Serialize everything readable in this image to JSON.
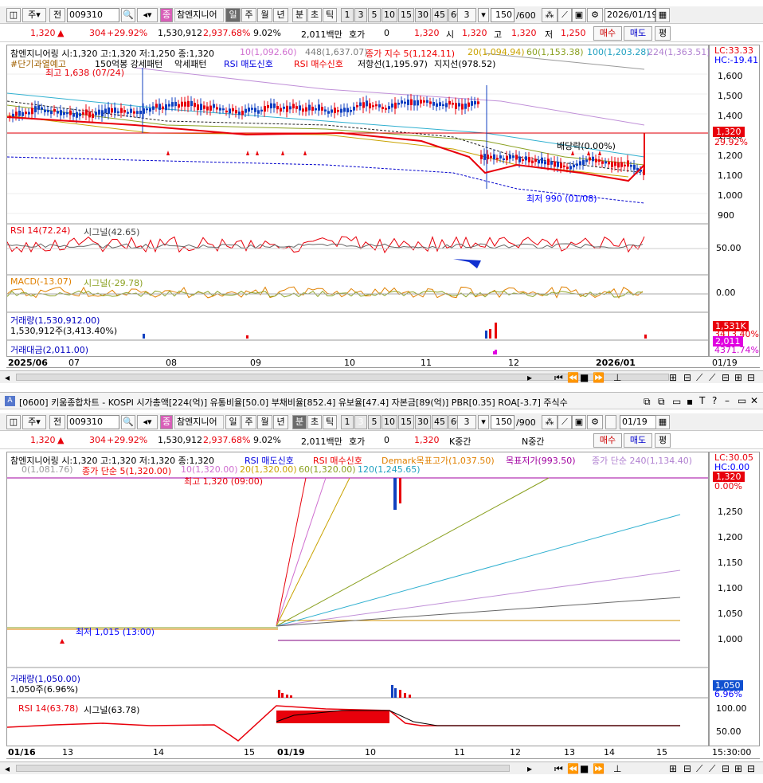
{
  "top": {
    "toolbar": {
      "type_label": "주",
      "prev_label": "전",
      "code": "009310",
      "stock_badge": "종",
      "stock_name": "참엔지니어",
      "periods": [
        "일",
        "주",
        "월",
        "년"
      ],
      "intraday": [
        "분",
        "초",
        "틱"
      ],
      "nums": [
        "1",
        "3",
        "5",
        "10",
        "15",
        "30",
        "45",
        "60"
      ],
      "count_sel": "3",
      "view_count": "150",
      "total_count": "/600",
      "date": "2026/01/19"
    },
    "quote": {
      "price": "1,320",
      "change": "304",
      "rate": "+29.92%",
      "volume": "1,530,912",
      "vol_rate": "2,937.68%",
      "turnover": "9.02%",
      "amount": "2,011백만",
      "hoga_label": "호가",
      "hoga_val": "0",
      "hoga_price": "1,320",
      "open_label": "시",
      "open": "1,320",
      "high_label": "고",
      "high": "1,320",
      "low_label": "저",
      "low": "1,250",
      "buy": "매수",
      "sell": "매도",
      "eval": "평"
    },
    "legend1": [
      "참엔지니어링 시:1,320 고:1,320 저:1,250 종:1,320",
      "10(1,092.60)",
      "448(1,637.07)",
      "종가 지수 5(1,124.11)",
      "20(1,094.94)",
      "60(1,153.38)",
      "100(1,203.28)",
      "224(1,363.51)"
    ],
    "legend2": [
      "#단기과열예고",
      "150억봉 강세패턴",
      "악세패턴",
      "RSI 매도신호",
      "RSI 매수신호",
      "저항선(1,195.97)",
      "지지선(978.52)"
    ],
    "lc": "LC:33.33",
    "hc": "HC:-19.41",
    "price_ticks": [
      "1,600",
      "1,500",
      "1,400",
      "1,300",
      "1,200",
      "1,100",
      "1,000",
      "900"
    ],
    "last_price_tag": "1,320",
    "rate_tag": "29.92%",
    "high_note": "최고 1,638 (07/24)",
    "low_note": "최저 990 (01/08)",
    "dividend_note": "배당락(0.00%)",
    "rsi_legend": "RSI 14(72.24)",
    "rsi_signal": "시그널(42.65)",
    "rsi_tick": "50.00",
    "macd_legend": "MACD(-13.07)",
    "macd_signal": "시그널(-29.78)",
    "macd_tick": "0.00",
    "vol_legend": "거래량(1,530,912.00)",
    "vol_value": "1,530,912주(3,413.40%)",
    "vol_tag": "1,531K",
    "vol_tag2": "3413.40%",
    "amt_legend": "거래대금(2,011.00)",
    "amt_tag": "2,011",
    "amt_tag2": "4371.74%",
    "x_labels": [
      "2025/06",
      "07",
      "08",
      "09",
      "10",
      "11",
      "12",
      "2026/01"
    ],
    "x_right": "01/19"
  },
  "bottom": {
    "title": "[0600] 키움종합차트 - KOSPI 시가총액[224(억)] 유통비율[50.0] 부채비율[852.4] 유보율[47.4] 자본금[89(억)] PBR[0.35] ROA[-3.7] 주식수",
    "toolbar": {
      "type_label": "주",
      "prev_label": "전",
      "code": "009310",
      "stock_badge": "종",
      "stock_name": "참엔지니어",
      "periods": [
        "일",
        "주",
        "월",
        "년"
      ],
      "intraday": [
        "분",
        "초",
        "틱"
      ],
      "nums": [
        "1",
        "3",
        "5",
        "10",
        "15",
        "30",
        "45",
        "60"
      ],
      "count_sel": "3",
      "view_count": "150",
      "total_count": "/900",
      "date": "01/19"
    },
    "quote": {
      "price": "1,320",
      "change": "304",
      "rate": "+29.92%",
      "volume": "1,530,912",
      "vol_rate": "2,937.68%",
      "turnover": "9.02%",
      "amount": "2,011백만",
      "hoga_label": "호가",
      "hoga_val": "0",
      "hoga_price": "1,320",
      "k_label": "K중간",
      "n_label": "N중간",
      "buy": "매수",
      "sell": "매도",
      "eval": "평"
    },
    "legend1": [
      "참엔지니어링 시:1,320 고:1,320 저:1,320 종:1,320",
      "RSI 매도신호",
      "RSI 매수신호",
      "Demark목표고가(1,037.50)",
      "목표저가(993.50)",
      "종가 단순 240(1,134.40)"
    ],
    "legend2": [
      "0(1,081.76)",
      "종가 단순 5(1,320.00)",
      "10(1,320.00)",
      "20(1,320.00)",
      "60(1,320.00)",
      "120(1,245.65)"
    ],
    "lc": "LC:30.05",
    "hc": "HC:0.00",
    "price_ticks": [
      "1,250",
      "1,200",
      "1,150",
      "1,100",
      "1,050",
      "1,000"
    ],
    "last_price_tag": "1,320",
    "rate_tag": "0.00%",
    "high_note": "최고 1,320 (09:00)",
    "low_note": "최저 1,015 (13:00)",
    "vol_legend": "거래량(1,050.00)",
    "vol_value": "1,050주(6.96%)",
    "vol_tag": "1,050",
    "vol_tag2": "6.96%",
    "rsi_legend": "RSI 14(63.78)",
    "rsi_signal": "시그널(63.78)",
    "rsi_ticks": [
      "100.00",
      "50.00"
    ],
    "x_labels": [
      "01/16",
      "13",
      "14",
      "15",
      "01/19",
      "10",
      "11",
      "12",
      "13",
      "14",
      "15"
    ],
    "x_right": "15:30:00"
  }
}
